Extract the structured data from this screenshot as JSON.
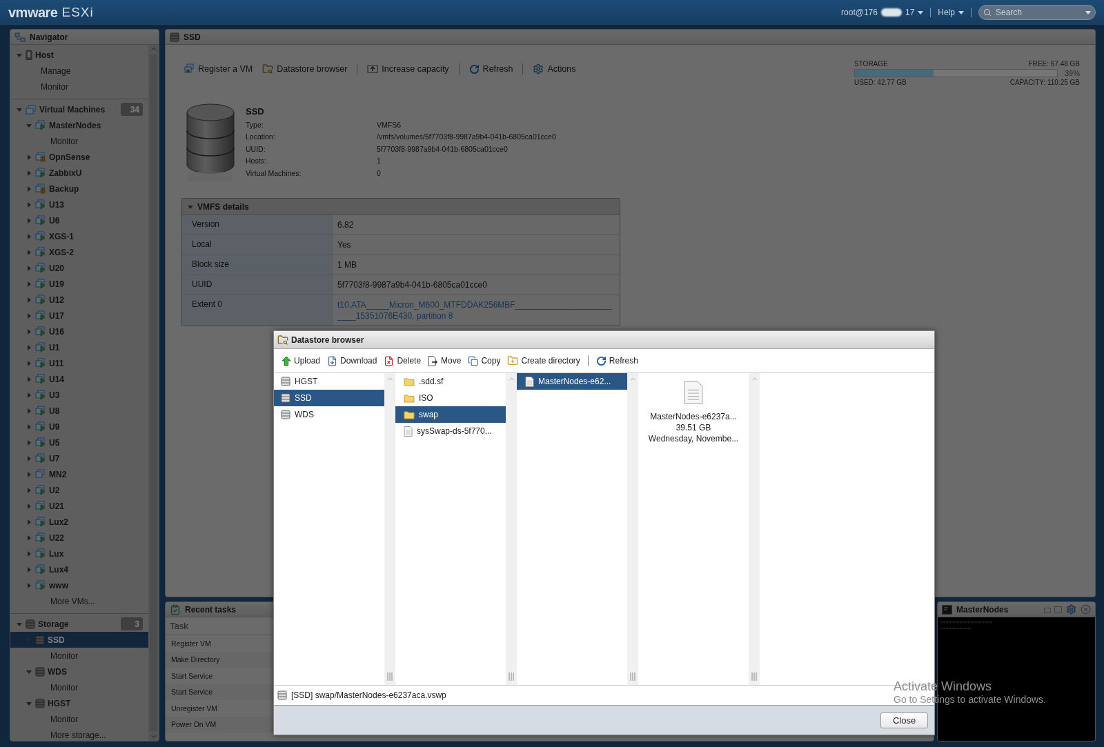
{
  "header": {
    "logo": "vmware",
    "product": "ESXi",
    "user_prefix": "root@176",
    "user_suffix": "17",
    "help": "Help",
    "search": {
      "placeholder": "Search"
    }
  },
  "navigator": {
    "title": "Navigator",
    "sections": [
      {
        "label": "Host",
        "kind": "host",
        "expanded": true,
        "selected": false,
        "children": [
          {
            "label": "Manage",
            "kind": "link",
            "selected": false
          },
          {
            "label": "Monitor",
            "kind": "link",
            "selected": false
          }
        ]
      },
      {
        "label": "Virtual Machines",
        "kind": "vms",
        "count": "34",
        "expanded": true,
        "selected": false,
        "children": [
          {
            "label": "MasterNodes",
            "kind": "vm",
            "running": true,
            "suspended": false,
            "expanded": true,
            "selected": false,
            "children": [
              {
                "label": "Monitor",
                "kind": "link",
                "selected": false
              }
            ]
          },
          {
            "label": "OpnSense",
            "kind": "vm",
            "running": false,
            "suspended": true,
            "expanded": false,
            "selected": false
          },
          {
            "label": "ZabbixU",
            "kind": "vm",
            "running": true,
            "suspended": false,
            "expanded": false,
            "selected": false
          },
          {
            "label": "Backup",
            "kind": "vm",
            "running": false,
            "suspended": true,
            "expanded": false,
            "selected": false
          },
          {
            "label": "U13",
            "kind": "vm",
            "running": true,
            "suspended": false,
            "expanded": false,
            "selected": false
          },
          {
            "label": "U6",
            "kind": "vm",
            "running": true,
            "suspended": false,
            "expanded": false,
            "selected": false
          },
          {
            "label": "XGS-1",
            "kind": "vm",
            "running": true,
            "suspended": false,
            "expanded": false,
            "selected": false
          },
          {
            "label": "XGS-2",
            "kind": "vm",
            "running": true,
            "suspended": false,
            "expanded": false,
            "selected": false
          },
          {
            "label": "U20",
            "kind": "vm",
            "running": true,
            "suspended": false,
            "expanded": false,
            "selected": false
          },
          {
            "label": "U19",
            "kind": "vm",
            "running": true,
            "suspended": false,
            "expanded": false,
            "selected": false
          },
          {
            "label": "U12",
            "kind": "vm",
            "running": true,
            "suspended": false,
            "expanded": false,
            "selected": false
          },
          {
            "label": "U17",
            "kind": "vm",
            "running": true,
            "suspended": false,
            "expanded": false,
            "selected": false
          },
          {
            "label": "U16",
            "kind": "vm",
            "running": true,
            "suspended": false,
            "expanded": false,
            "selected": false
          },
          {
            "label": "U1",
            "kind": "vm",
            "running": true,
            "suspended": false,
            "expanded": false,
            "selected": false
          },
          {
            "label": "U11",
            "kind": "vm",
            "running": true,
            "suspended": false,
            "expanded": false,
            "selected": false
          },
          {
            "label": "U14",
            "kind": "vm",
            "running": true,
            "suspended": false,
            "expanded": false,
            "selected": false
          },
          {
            "label": "U3",
            "kind": "vm",
            "running": true,
            "suspended": false,
            "expanded": false,
            "selected": false
          },
          {
            "label": "U8",
            "kind": "vm",
            "running": true,
            "suspended": false,
            "expanded": false,
            "selected": false
          },
          {
            "label": "U9",
            "kind": "vm",
            "running": true,
            "suspended": false,
            "expanded": false,
            "selected": false
          },
          {
            "label": "U5",
            "kind": "vm",
            "running": true,
            "suspended": false,
            "expanded": false,
            "selected": false
          },
          {
            "label": "U7",
            "kind": "vm",
            "running": true,
            "suspended": false,
            "expanded": false,
            "selected": false
          },
          {
            "label": "MN2",
            "kind": "vm",
            "running": false,
            "suspended": false,
            "expanded": false,
            "selected": false
          },
          {
            "label": "U2",
            "kind": "vm",
            "running": true,
            "suspended": false,
            "expanded": false,
            "selected": false
          },
          {
            "label": "U21",
            "kind": "vm",
            "running": true,
            "suspended": false,
            "expanded": false,
            "selected": false
          },
          {
            "label": "Lux2",
            "kind": "vm",
            "running": true,
            "suspended": false,
            "expanded": false,
            "selected": false
          },
          {
            "label": "U22",
            "kind": "vm",
            "running": true,
            "suspended": false,
            "expanded": false,
            "selected": false
          },
          {
            "label": "Lux",
            "kind": "vm",
            "running": true,
            "suspended": false,
            "expanded": false,
            "selected": false
          },
          {
            "label": "Lux4",
            "kind": "vm",
            "running": true,
            "suspended": false,
            "expanded": false,
            "selected": false
          },
          {
            "label": "www",
            "kind": "vm",
            "running": true,
            "suspended": false,
            "expanded": false,
            "selected": false
          },
          {
            "label": "More VMs...",
            "kind": "link",
            "selected": false
          }
        ]
      },
      {
        "label": "Storage",
        "kind": "storage",
        "count": "3",
        "expanded": true,
        "selected": false,
        "children": [
          {
            "label": "SSD",
            "kind": "datastore",
            "expanded": true,
            "selected": true,
            "children": [
              {
                "label": "Monitor",
                "kind": "link",
                "selected": false
              }
            ]
          },
          {
            "label": "WDS",
            "kind": "datastore",
            "expanded": true,
            "selected": false,
            "children": [
              {
                "label": "Monitor",
                "kind": "link",
                "selected": false
              }
            ]
          },
          {
            "label": "HGST",
            "kind": "datastore",
            "expanded": true,
            "selected": false,
            "children": [
              {
                "label": "Monitor",
                "kind": "link",
                "selected": false
              }
            ]
          },
          {
            "label": "More storage...",
            "kind": "link",
            "selected": false
          }
        ]
      }
    ]
  },
  "main": {
    "title": "SSD",
    "actions": [
      "Register a VM",
      "Datastore browser",
      "Increase capacity",
      "Refresh",
      "Actions"
    ],
    "storage": {
      "label": "STORAGE",
      "free": "FREE: 67.48 GB",
      "percent": "39%",
      "level": 0.39,
      "used": "USED: 42.77 GB",
      "capacity": "CAPACITY: 110.25 GB"
    },
    "summary": {
      "name": "SSD",
      "properties": [
        {
          "label": "Type:",
          "value": "VMFS6"
        },
        {
          "label": "Location:",
          "value": "/vmfs/volumes/5f7703f8-9987a9b4-041b-6805ca01cce0"
        },
        {
          "label": "UUID:",
          "value": "5f7703f8-9987a9b4-041b-6805ca01cce0"
        },
        {
          "label": "Hosts:",
          "value": "1"
        },
        {
          "label": "Virtual Machines:",
          "value": "0"
        }
      ]
    },
    "vmfs_details": {
      "title": "VMFS details",
      "expanded": true,
      "rows": [
        {
          "label": "Version",
          "value": "6.82",
          "kind": "text"
        },
        {
          "label": "Local",
          "value": "Yes",
          "kind": "text"
        },
        {
          "label": "Block size",
          "value": "1 MB",
          "kind": "text"
        },
        {
          "label": "UUID",
          "value": "5f7703f8-9987a9b4-041b-6805ca01cce0",
          "kind": "text"
        },
        {
          "label": "Extent 0",
          "value": "t10.ATA_____Micron_M600_MTFDDAK256MBF_________________________15351076E430, partition 8",
          "kind": "link"
        }
      ]
    }
  },
  "recent_tasks": {
    "title": "Recent tasks",
    "column": "Task",
    "rows": [
      "Register VM",
      "Make Directory",
      "Start Service",
      "Start Service",
      "Unregister VM",
      "Power On VM"
    ]
  },
  "console": {
    "title": "MasterNodes"
  },
  "dialog": {
    "title": "Datastore browser",
    "toolbar": [
      "Upload",
      "Download",
      "Delete",
      "Move",
      "Copy",
      "Create directory",
      "Refresh"
    ],
    "columns": [
      [
        {
          "label": "HGST",
          "kind": "datastore",
          "selected": false
        },
        {
          "label": "SSD",
          "kind": "datastore",
          "selected": true
        },
        {
          "label": "WDS",
          "kind": "datastore",
          "selected": false
        }
      ],
      [
        {
          "label": ".sdd.sf",
          "kind": "folder",
          "selected": false
        },
        {
          "label": "ISO",
          "kind": "folder",
          "selected": false
        },
        {
          "label": "swap",
          "kind": "folder",
          "selected": true
        },
        {
          "label": "sysSwap-ds-5f770...",
          "kind": "file",
          "selected": false
        }
      ],
      [
        {
          "label": "MasterNodes-e62...",
          "kind": "file",
          "selected": true
        }
      ]
    ],
    "preview": {
      "name": "MasterNodes-e6237a...",
      "size": "39.51 GB",
      "date": "Wednesday, Novembe..."
    },
    "path": "[SSD] swap/MasterNodes-e6237aca.vswp",
    "close": "Close"
  },
  "os_notice": {
    "title": "Activate Windows",
    "message": "Go to Settings to activate Windows."
  }
}
